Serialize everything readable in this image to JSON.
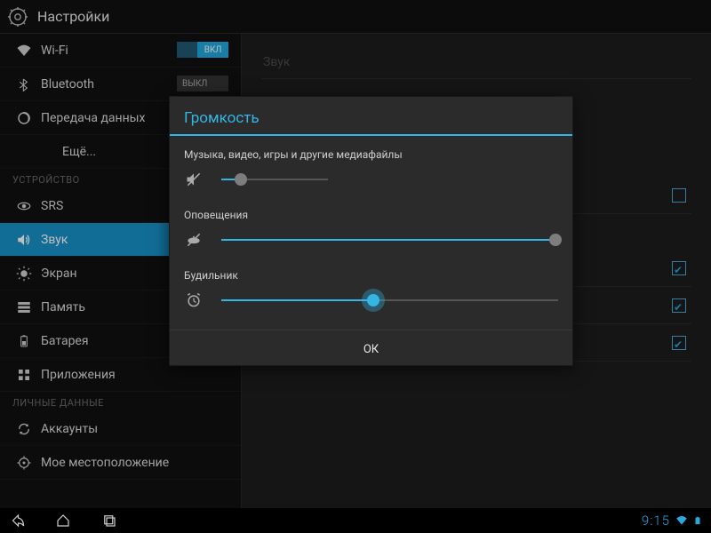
{
  "header": {
    "title": "Настройки"
  },
  "sidebar": {
    "items": [
      {
        "label": "Wi-Fi",
        "toggle": "ВКЛ"
      },
      {
        "label": "Bluetooth",
        "toggle": "ВЫКЛ"
      },
      {
        "label": "Передача данных"
      },
      {
        "label": "Ещё..."
      }
    ],
    "heading_device": "УСТРОЙСТВО",
    "device": [
      {
        "label": "SRS"
      },
      {
        "label": "Звук"
      },
      {
        "label": "Экран"
      },
      {
        "label": "Память"
      },
      {
        "label": "Батарея"
      },
      {
        "label": "Приложения"
      }
    ],
    "heading_personal": "ЛИЧНЫЕ ДАННЫЕ",
    "personal": [
      {
        "label": "Аккаунты"
      },
      {
        "label": "Мое местоположение"
      }
    ]
  },
  "content": {
    "section": "Звук",
    "checks": [
      false,
      true,
      true,
      true
    ]
  },
  "dialog": {
    "title": "Громкость",
    "media_label": "Музыка, видео, игры и другие медиафайлы",
    "notif_label": "Оповещения",
    "alarm_label": "Будильник",
    "ok": "ОК",
    "sliders": {
      "media": 0.18,
      "notif": 1.0,
      "alarm": 0.45
    }
  },
  "status": {
    "time": "9:15"
  },
  "colors": {
    "accent": "#33b5e5"
  }
}
